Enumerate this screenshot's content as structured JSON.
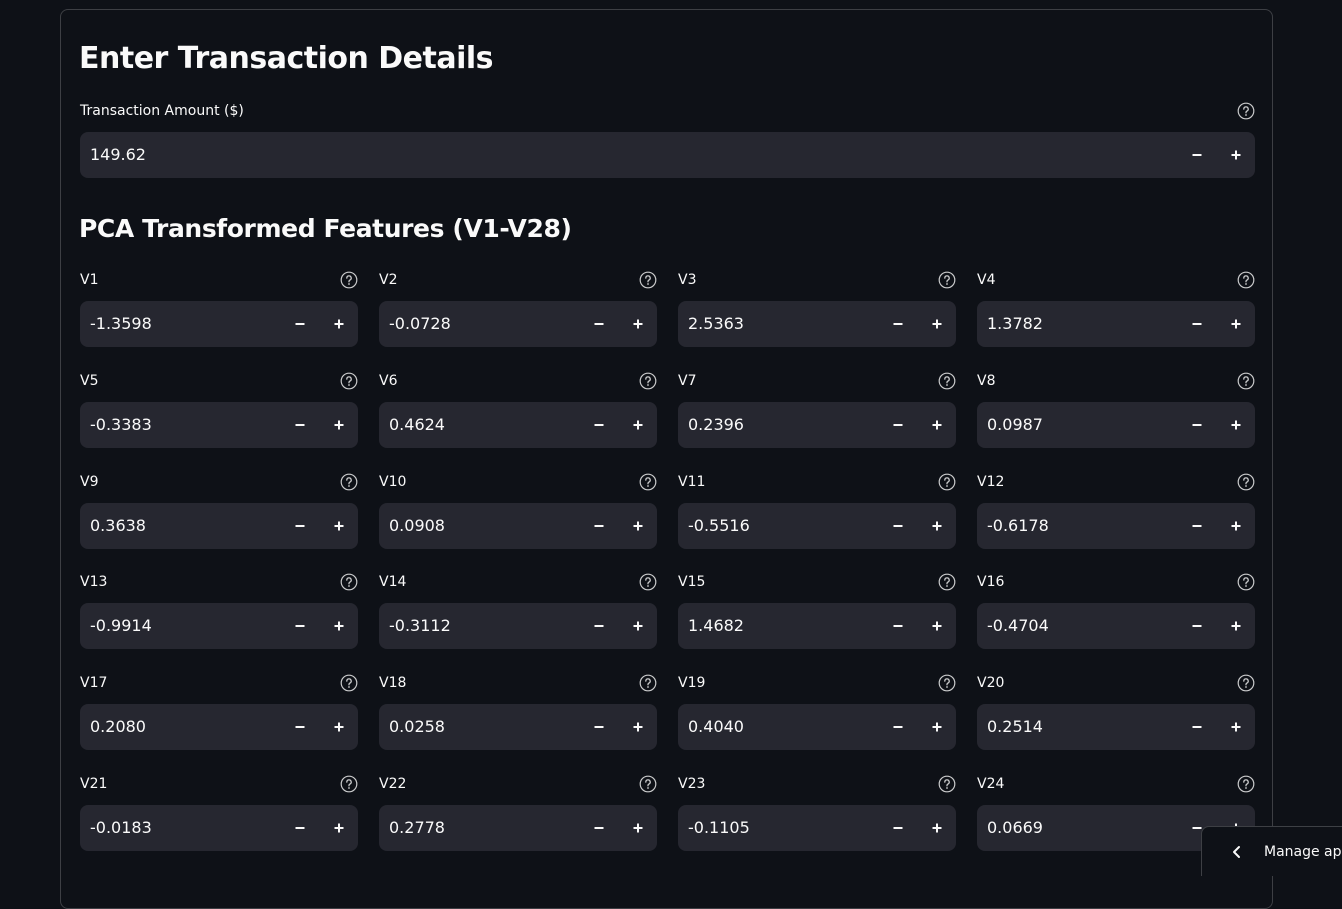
{
  "form": {
    "title": "Enter Transaction Details",
    "amount": {
      "label": "Transaction Amount ($)",
      "value": "149.62"
    },
    "pca_title": "PCA Transformed Features (V1-V28)",
    "features": [
      {
        "label": "V1",
        "value": "-1.3598"
      },
      {
        "label": "V2",
        "value": "-0.0728"
      },
      {
        "label": "V3",
        "value": "2.5363"
      },
      {
        "label": "V4",
        "value": "1.3782"
      },
      {
        "label": "V5",
        "value": "-0.3383"
      },
      {
        "label": "V6",
        "value": "0.4624"
      },
      {
        "label": "V7",
        "value": "0.2396"
      },
      {
        "label": "V8",
        "value": "0.0987"
      },
      {
        "label": "V9",
        "value": "0.3638"
      },
      {
        "label": "V10",
        "value": "0.0908"
      },
      {
        "label": "V11",
        "value": "-0.5516"
      },
      {
        "label": "V12",
        "value": "-0.6178"
      },
      {
        "label": "V13",
        "value": "-0.9914"
      },
      {
        "label": "V14",
        "value": "-0.3112"
      },
      {
        "label": "V15",
        "value": "1.4682"
      },
      {
        "label": "V16",
        "value": "-0.4704"
      },
      {
        "label": "V17",
        "value": "0.2080"
      },
      {
        "label": "V18",
        "value": "0.0258"
      },
      {
        "label": "V19",
        "value": "0.4040"
      },
      {
        "label": "V20",
        "value": "0.2514"
      },
      {
        "label": "V21",
        "value": "-0.0183"
      },
      {
        "label": "V22",
        "value": "0.2778"
      },
      {
        "label": "V23",
        "value": "-0.1105"
      },
      {
        "label": "V24",
        "value": "0.0669"
      }
    ]
  },
  "manage_app": {
    "label": "Manage app"
  },
  "icons": {
    "help": "question-circle-icon",
    "minus": "minus-icon",
    "plus": "plus-icon",
    "chevron": "chevron-left-icon"
  },
  "colors": {
    "background": "#0e1117",
    "input_background": "#262730",
    "text": "#fafafa"
  }
}
